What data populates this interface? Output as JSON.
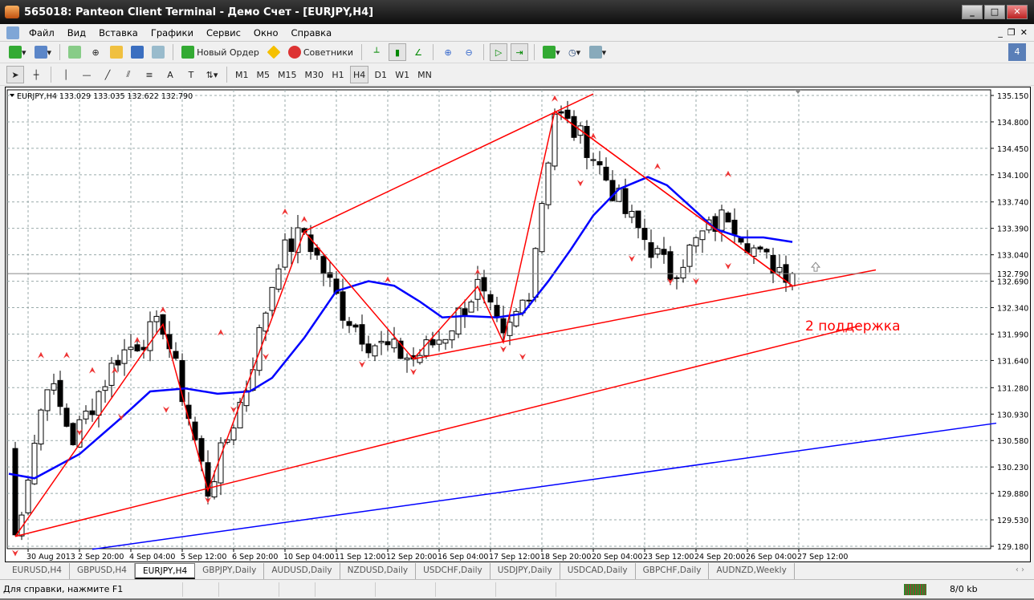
{
  "window": {
    "title": "565018: Panteon Client Terminal - Демо Счет - [EURJPY,H4]",
    "min": "_",
    "max": "□",
    "close": "✕"
  },
  "menu": [
    "Файл",
    "Вид",
    "Вставка",
    "Графики",
    "Сервис",
    "Окно",
    "Справка"
  ],
  "mdi": [
    "_",
    "❐",
    "✕"
  ],
  "toolbar1": {
    "new_order": "Новый Ордер",
    "advisors": "Советники"
  },
  "toolbar2": {
    "timeframes": [
      "M1",
      "M5",
      "M15",
      "M30",
      "H1",
      "H4",
      "D1",
      "W1",
      "MN"
    ],
    "active": "H4",
    "tools": [
      "A",
      "T"
    ]
  },
  "chart_data": {
    "type": "candlestick",
    "symbol_header": "EURJPY,H4  133.029 133.035 132.622 132.790",
    "current_price": 132.79,
    "current_price_label": "132.790",
    "ylim": [
      129.18,
      135.15
    ],
    "y_ticks": [
      "135.150",
      "134.800",
      "134.450",
      "134.100",
      "133.740",
      "133.390",
      "133.040",
      "132.690",
      "132.340",
      "131.990",
      "131.640",
      "131.280",
      "130.930",
      "130.580",
      "130.230",
      "129.880",
      "129.530",
      "129.180"
    ],
    "x_ticks": [
      {
        "bar": 3,
        "label": "30 Aug 2013"
      },
      {
        "bar": 11,
        "label": "2 Sep 20:00"
      },
      {
        "bar": 19,
        "label": "4 Sep 04:00"
      },
      {
        "bar": 27,
        "label": "5 Sep 12:00"
      },
      {
        "bar": 35,
        "label": "6 Sep 20:00"
      },
      {
        "bar": 43,
        "label": "10 Sep 04:00"
      },
      {
        "bar": 51,
        "label": "11 Sep 12:00"
      },
      {
        "bar": 59,
        "label": "12 Sep 20:00"
      },
      {
        "bar": 67,
        "label": "16 Sep 04:00"
      },
      {
        "bar": 75,
        "label": "17 Sep 12:00"
      },
      {
        "bar": 83,
        "label": "18 Sep 20:00"
      },
      {
        "bar": 91,
        "label": "20 Sep 04:00"
      },
      {
        "bar": 99,
        "label": "23 Sep 12:00"
      },
      {
        "bar": 107,
        "label": "24 Sep 20:00"
      },
      {
        "bar": 115,
        "label": "26 Sep 04:00"
      },
      {
        "bar": 123,
        "label": "27 Sep 12:00"
      }
    ],
    "bars_visible": 153,
    "zigzag_pivots": [
      [
        0,
        130.5
      ],
      [
        1,
        129.31
      ],
      [
        6,
        131.4
      ],
      [
        10,
        130.6
      ],
      [
        17,
        131.7
      ],
      [
        24,
        132.12
      ],
      [
        28,
        130.9
      ],
      [
        31,
        129.92
      ],
      [
        37,
        131.3
      ],
      [
        42,
        133.0
      ],
      [
        46,
        133.35
      ],
      [
        52,
        132.3
      ],
      [
        56,
        131.9
      ],
      [
        63,
        131.66
      ],
      [
        68,
        132.0
      ],
      [
        73,
        132.62
      ],
      [
        77,
        131.88
      ],
      [
        81,
        132.6
      ],
      [
        85,
        134.94
      ],
      [
        90,
        134.5
      ],
      [
        96,
        133.6
      ],
      [
        103,
        132.79
      ],
      [
        108,
        133.3
      ],
      [
        112,
        133.59
      ],
      [
        117,
        133.0
      ],
      [
        122,
        132.79
      ]
    ],
    "ma": [
      [
        0,
        130.14
      ],
      [
        4,
        130.08
      ],
      [
        11,
        130.4
      ],
      [
        17.5,
        130.88
      ],
      [
        22,
        131.23
      ],
      [
        27.5,
        131.27
      ],
      [
        32.5,
        131.2
      ],
      [
        37.5,
        131.23
      ],
      [
        41,
        131.41
      ],
      [
        46,
        131.94
      ],
      [
        51,
        132.56
      ],
      [
        56,
        132.69
      ],
      [
        60,
        132.63
      ],
      [
        64,
        132.42
      ],
      [
        67.5,
        132.21
      ],
      [
        71,
        132.23
      ],
      [
        76,
        132.21
      ],
      [
        80,
        132.26
      ],
      [
        84,
        132.69
      ],
      [
        87.5,
        133.11
      ],
      [
        91,
        133.56
      ],
      [
        95,
        133.91
      ],
      [
        99.5,
        134.07
      ],
      [
        102.5,
        133.96
      ],
      [
        106,
        133.69
      ],
      [
        110,
        133.38
      ],
      [
        114,
        133.27
      ],
      [
        117.5,
        133.27
      ],
      [
        122,
        133.21
      ]
    ],
    "zigzag_lines": [
      [
        1,
        129.31
      ],
      [
        24,
        132.12
      ],
      [
        31,
        129.92
      ],
      [
        46,
        133.35
      ],
      [
        63,
        131.66
      ],
      [
        73,
        132.62
      ],
      [
        77,
        131.88
      ],
      [
        85,
        134.94
      ],
      [
        122,
        132.63
      ]
    ],
    "trendlines": [
      {
        "color": "#ff0000",
        "from": [
          1,
          129.31
        ],
        "to": [
          132.5,
          132.1
        ]
      },
      {
        "color": "#ff0000",
        "from": [
          63,
          131.66
        ],
        "to": [
          135,
          132.84
        ]
      },
      {
        "color": "#ff0000",
        "from": [
          46,
          133.35
        ],
        "to": [
          91,
          135.17
        ]
      },
      {
        "color": "#ff0000",
        "from": [
          85,
          134.94
        ],
        "to": [
          122,
          132.63
        ]
      },
      {
        "color": "#0000ff",
        "from": [
          13,
          129.14
        ],
        "to": [
          153.75,
          130.81
        ]
      }
    ],
    "fractals_up": [
      [
        5,
        131.7
      ],
      [
        9,
        131.7
      ],
      [
        13,
        131.5
      ],
      [
        16.5,
        131.5
      ],
      [
        20,
        131.9
      ],
      [
        24,
        132.3
      ],
      [
        33,
        132.0
      ],
      [
        43,
        133.6
      ],
      [
        46,
        133.5
      ],
      [
        59,
        132.7
      ],
      [
        73,
        132.8
      ],
      [
        85,
        135.1
      ],
      [
        91,
        134.6
      ],
      [
        101,
        134.2
      ],
      [
        112,
        134.1
      ]
    ],
    "fractals_down": [
      [
        1,
        129.1
      ],
      [
        11,
        130.7
      ],
      [
        17.5,
        130.9
      ],
      [
        24.5,
        131.0
      ],
      [
        31,
        129.8
      ],
      [
        35,
        131.0
      ],
      [
        40,
        131.7
      ],
      [
        55,
        131.6
      ],
      [
        63,
        131.5
      ],
      [
        77,
        131.8
      ],
      [
        80,
        131.7
      ],
      [
        89,
        134.0
      ],
      [
        97,
        133.0
      ],
      [
        103,
        132.7
      ],
      [
        107,
        132.7
      ],
      [
        112,
        132.9
      ]
    ],
    "annotation": {
      "text": "2 поддержка",
      "color": "#ff0000",
      "bar": 124,
      "price": 132.1
    },
    "colors": {
      "zigzag": "#ff0000",
      "ma": "#0000ff",
      "bull": "#ffffff",
      "bear": "#000000"
    }
  },
  "tabs": [
    "EURUSD,H4",
    "GBPUSD,H4",
    "EURJPY,H4",
    "GBPJPY,Daily",
    "AUDUSD,Daily",
    "NZDUSD,Daily",
    "USDCHF,Daily",
    "USDJPY,Daily",
    "USDCAD,Daily",
    "GBPCHF,Daily",
    "AUDNZD,Weekly"
  ],
  "active_tab": "EURJPY,H4",
  "tab_scroll": "‹ ›",
  "status": {
    "help": "Для справки, нажмите F1",
    "traffic": "8/0 kb"
  }
}
